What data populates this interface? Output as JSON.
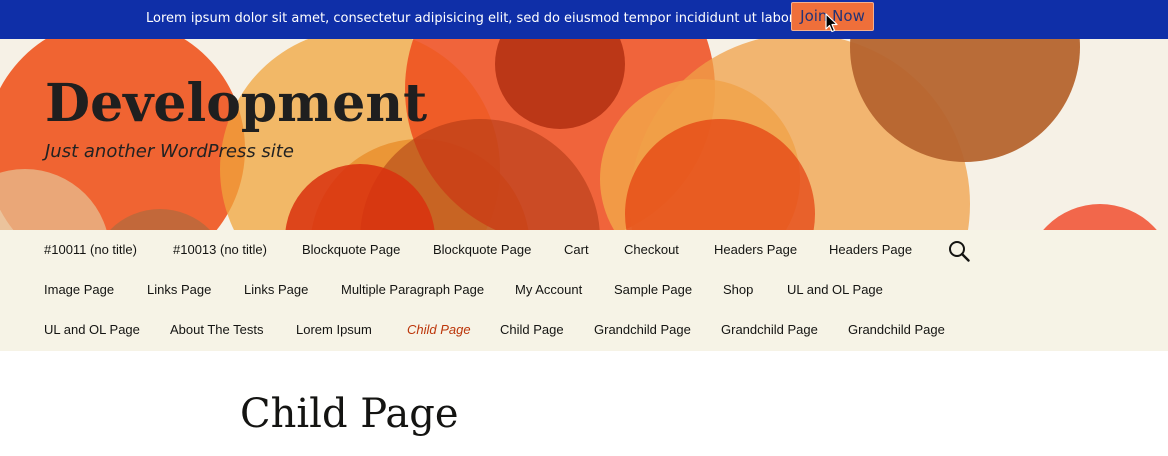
{
  "notice": {
    "text": "Lorem ipsum dolor sit amet, consectetur adipisicing elit, sed do eiusmod tempor incididunt ut labore et",
    "button_label": "Join Now"
  },
  "header": {
    "site_title": "Development",
    "site_description": "Just another WordPress site"
  },
  "nav": {
    "items": [
      {
        "label": "#10011 (no title)"
      },
      {
        "label": "#10013 (no title)"
      },
      {
        "label": "Blockquote Page"
      },
      {
        "label": "Blockquote Page"
      },
      {
        "label": "Cart"
      },
      {
        "label": "Checkout"
      },
      {
        "label": "Headers Page"
      },
      {
        "label": "Headers Page"
      },
      {
        "label": "Image Page"
      },
      {
        "label": "Links Page"
      },
      {
        "label": "Links Page"
      },
      {
        "label": "Multiple Paragraph Page"
      },
      {
        "label": "My Account"
      },
      {
        "label": "Sample Page"
      },
      {
        "label": "Shop"
      },
      {
        "label": "UL and OL Page"
      },
      {
        "label": "UL and OL Page"
      },
      {
        "label": "About The Tests"
      },
      {
        "label": "Lorem Ipsum"
      },
      {
        "label": "Child Page",
        "current": true
      },
      {
        "label": "Child Page"
      },
      {
        "label": "Grandchild Page"
      },
      {
        "label": "Grandchild Page"
      },
      {
        "label": "Grandchild Page"
      }
    ],
    "search_icon": "search-icon"
  },
  "content": {
    "title": "Child Page"
  },
  "colors": {
    "notice_bg": "#0f2fa8",
    "button_bg": "#ef6f3a",
    "header_bg": "#f6f1e6",
    "nav_bg": "#f6f3e6",
    "current_link": "#bc360a"
  }
}
